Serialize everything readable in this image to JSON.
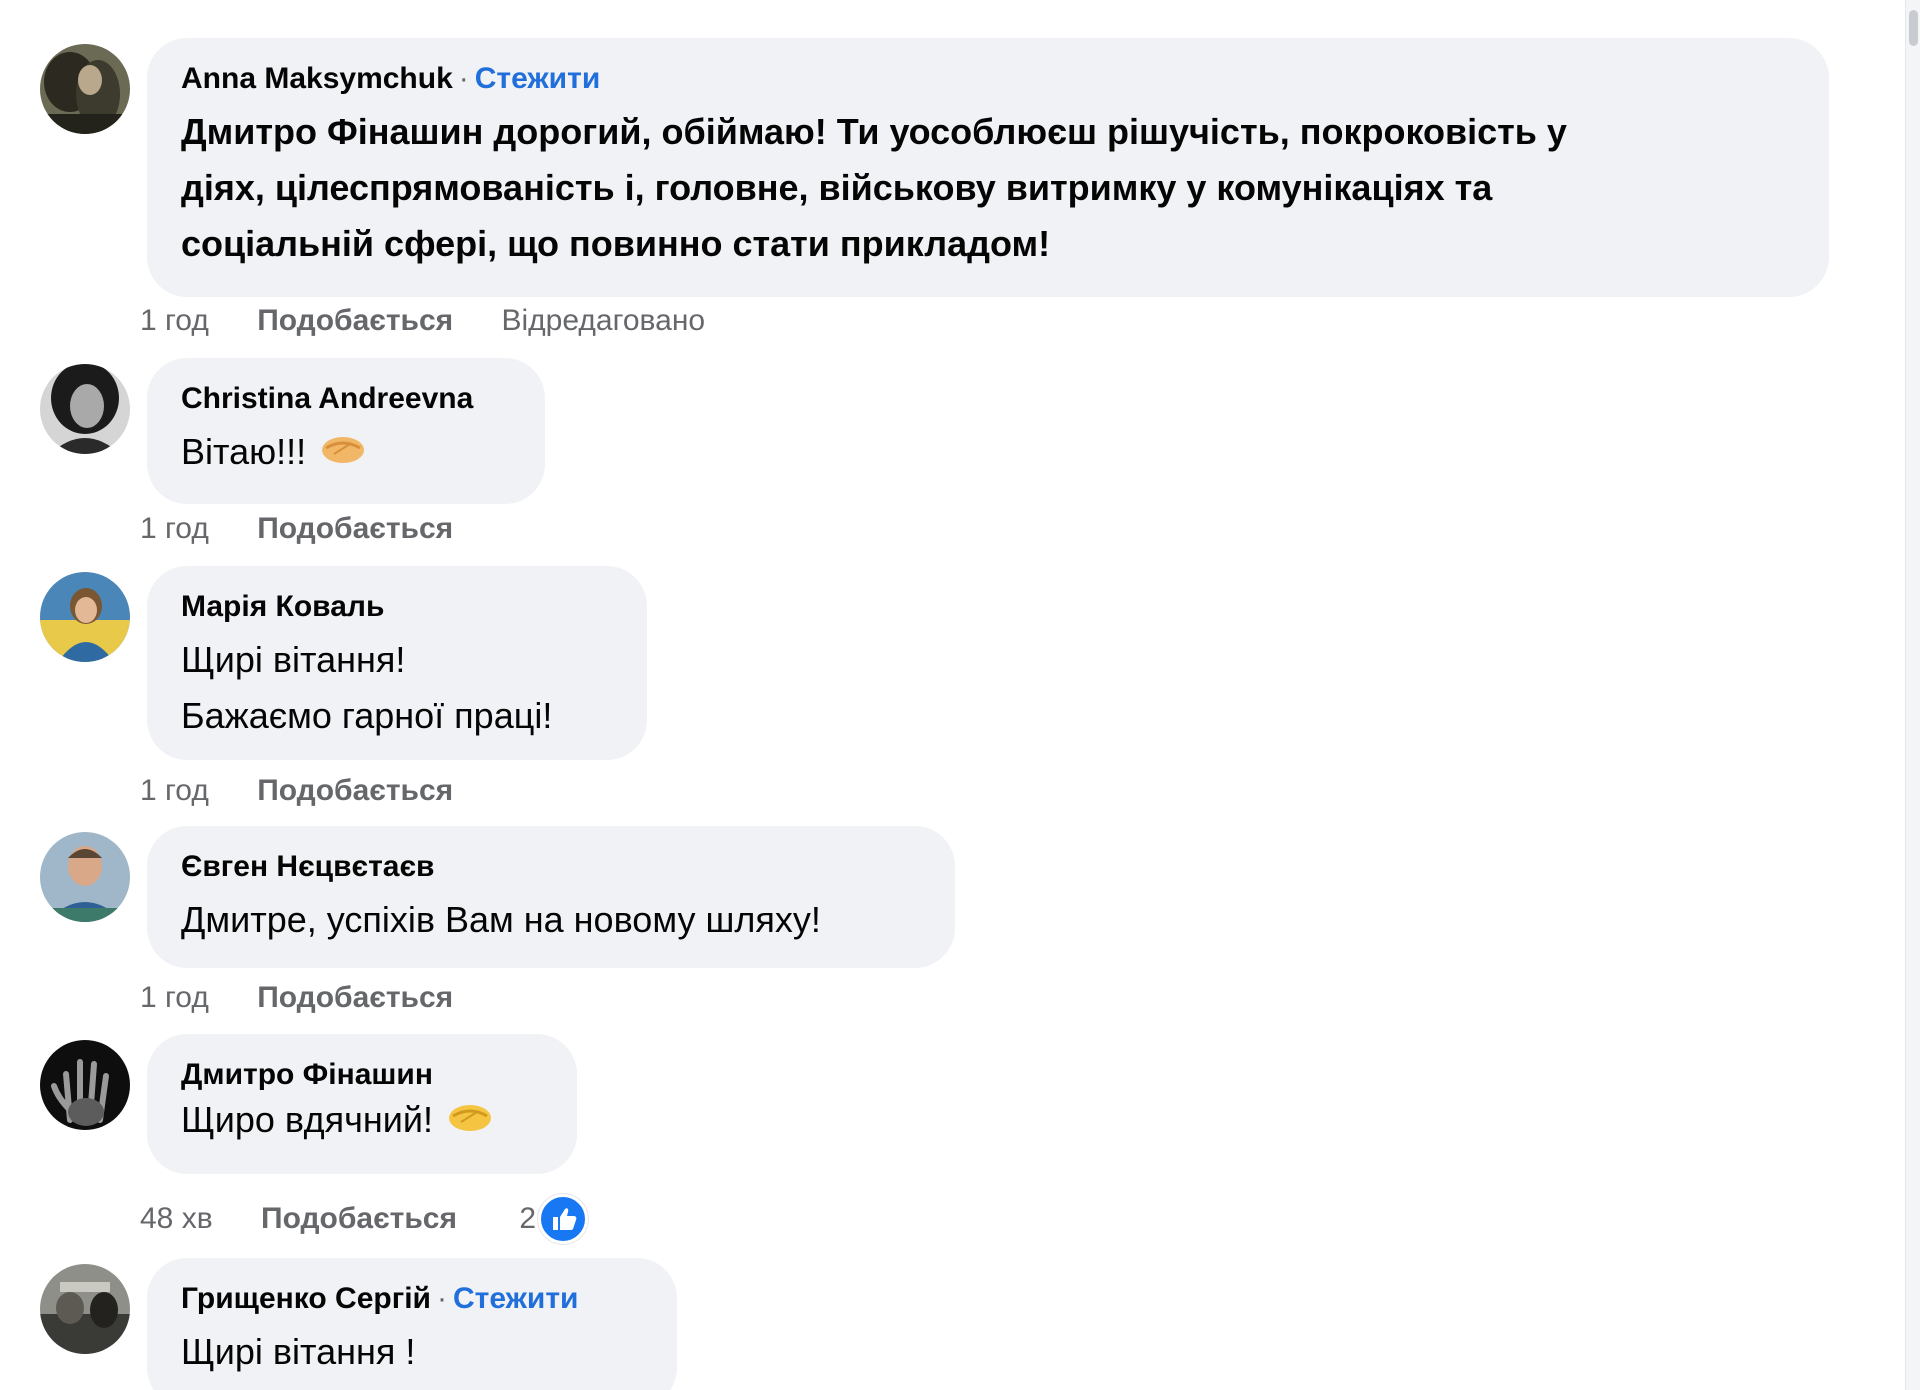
{
  "comments": [
    {
      "author": "Anna Maksymchuk",
      "separator": "·",
      "follow": "Стежити",
      "text": "Дмитро Фінашин дорогий, обіймаю! Ти уособлюєш рішучість, покроковість у\nдіях, цілеспрямованість і, головне, військову витримку у комунікаціях та\nсоціальній сфері, що повинно стати прикладом!",
      "time": "1 год",
      "like": "Подобається",
      "edited": "Відредаговано"
    },
    {
      "author": "Christina Andreevna",
      "text": "Вітаю!!!",
      "emoji": "handshake-icon",
      "time": "1 год",
      "like": "Подобається"
    },
    {
      "author": "Марія Коваль",
      "text": "Щирі вітання!\nБажаємо гарної праці!",
      "time": "1 год",
      "like": "Подобається"
    },
    {
      "author": "Євген Нєцвєтаєв",
      "text": "Дмитре, успіхів Вам на новому шляху!",
      "time": "1 год",
      "like": "Подобається"
    },
    {
      "author": "Дмитро Фінашин",
      "text": "Щиро вдячний!",
      "emoji": "handshake-icon",
      "time": "48 хв",
      "like": "Подобається",
      "reaction_count": "2",
      "reaction_icon": "thumbs-up-icon"
    },
    {
      "author": "Грищенко Сергій",
      "separator": "·",
      "follow": "Стежити",
      "text": "Щирі вітання !"
    }
  ],
  "colors": {
    "bubble": "#f0f2f5",
    "follow_link": "#216fdb",
    "meta_text": "#65676b",
    "like_reaction": "#1877f2"
  }
}
